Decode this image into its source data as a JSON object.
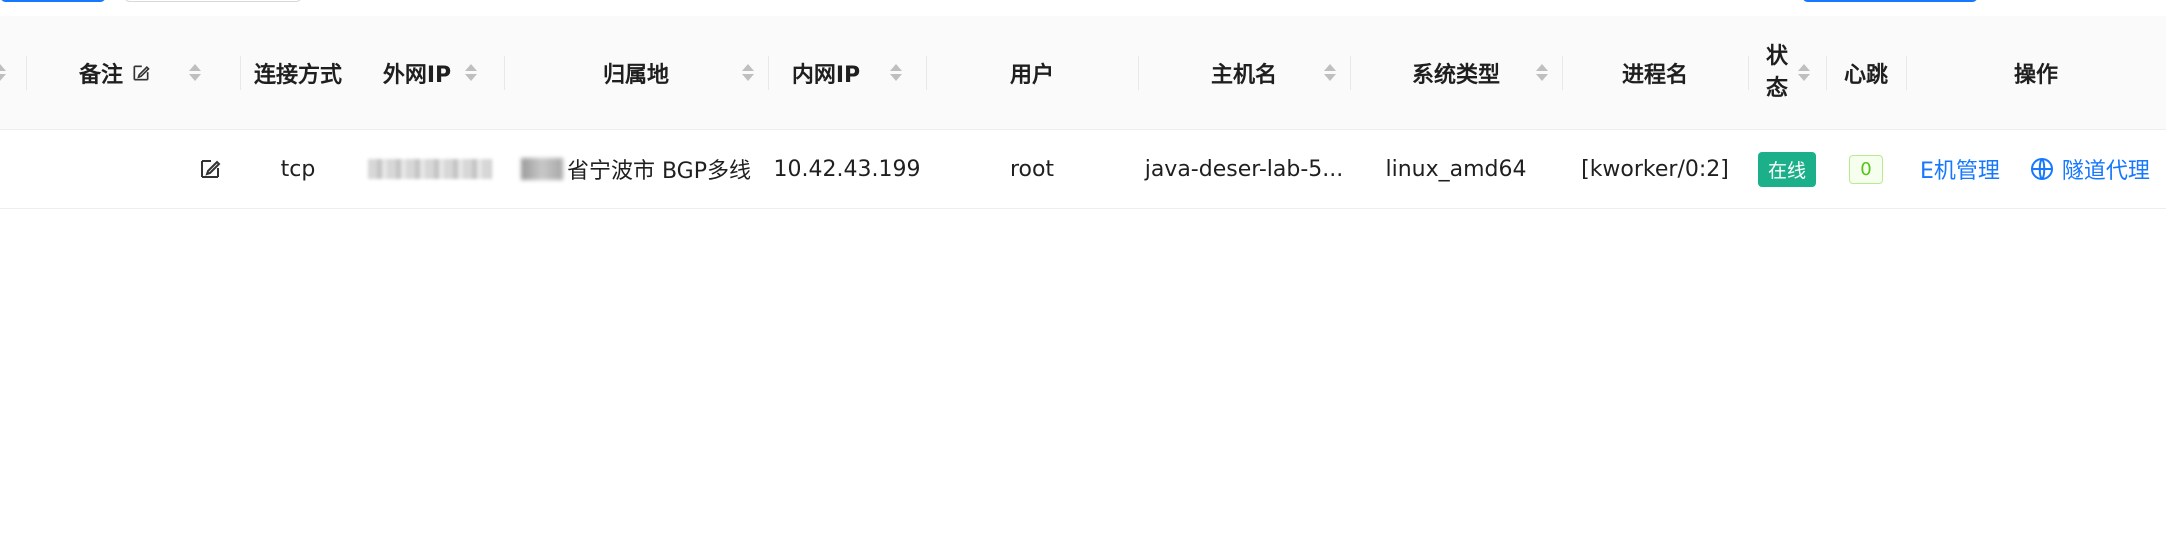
{
  "table": {
    "columns": {
      "remark": "备注",
      "conn": "连接方式",
      "public_ip": "外网IP",
      "location": "归属地",
      "private_ip": "内网IP",
      "user": "用户",
      "hostname": "主机名",
      "os": "系统类型",
      "process": "进程名",
      "status": "状态",
      "heartbeat": "心跳",
      "actions": "操作"
    },
    "row": {
      "conn": "tcp",
      "location_suffix": "省宁波市 BGP多线",
      "private_ip": "10.42.43.199",
      "user": "root",
      "hostname": "java-deser-lab-5...",
      "os": "linux_amd64",
      "process": "[kworker/0:2]",
      "status": "在线",
      "heartbeat": "0",
      "action_host": "E机管理",
      "action_tunnel": "隧道代理"
    }
  },
  "colors": {
    "primary": "#1677ff",
    "online": "#1bb089",
    "heartbeat_border": "#b7eb8f"
  },
  "icons": {
    "edit": "edit-icon",
    "globe": "globe-icon",
    "sort": "sort-icon"
  }
}
